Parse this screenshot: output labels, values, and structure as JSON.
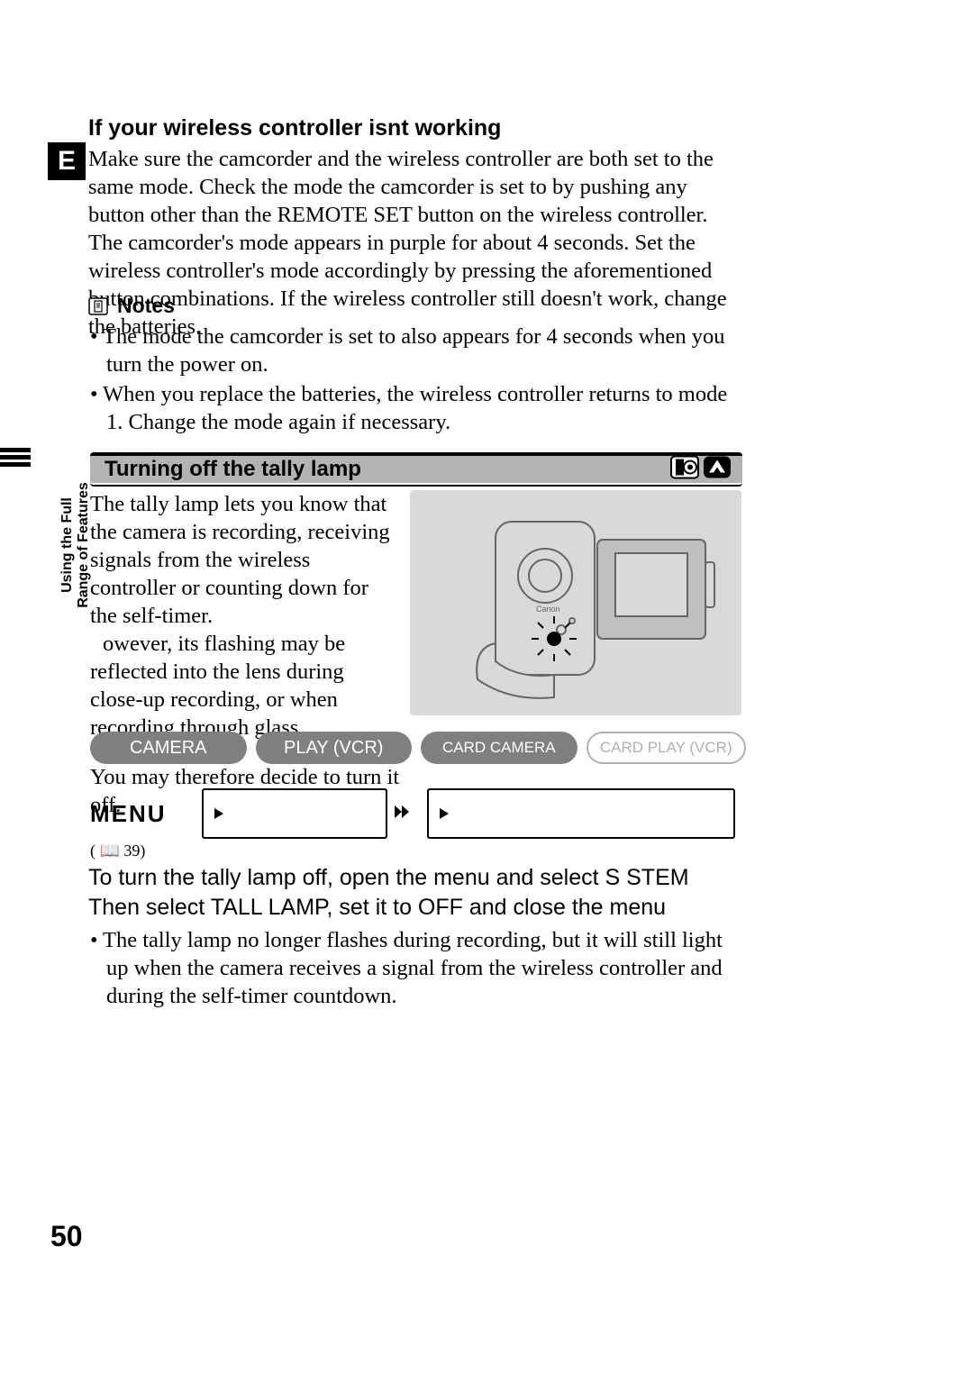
{
  "lang_badge": "E",
  "page_number": "50",
  "section1": {
    "heading": "If your wireless controller isnt working",
    "paragraph": "Make sure the camcorder and the wireless controller are both set to the same mode. Check the mode the camcorder is set to by pushing any button other than the REMOTE SET button on the wireless controller. The camcorder's mode appears in purple for about 4 seconds. Set the wireless controller's mode accordingly by pressing the aforementioned button combinations. If the wireless controller still doesn't work, change the batteries."
  },
  "notes": {
    "label": "Notes",
    "items": [
      "The mode the camcorder is set to also appears for 4 seconds when you turn the power on.",
      "When you replace the batteries, the wireless controller returns to mode 1. Change the mode again if necessary."
    ]
  },
  "section2": {
    "title": "Turning off the tally lamp",
    "para1": "The tally lamp lets you know that the camera is recording, receiving signals from the wireless controller or counting down for the self-timer.",
    "para2_leading_spaces": "   ",
    "para2": "owever, its flashing may be reflected into the lens during close-up recording, or when recording through glass.",
    "para3": "You may therefore decide to turn it off."
  },
  "side_tab": {
    "line1": "Using the Full",
    "line2": "Range of Features"
  },
  "modes": {
    "camera": "CAMERA",
    "play_vcr": "PLAY (VCR)",
    "card_camera": "CARD CAMERA",
    "card_play_vcr": "CARD PLAY (VCR)"
  },
  "menu": {
    "label": "MENU",
    "page_ref": "( 📖 39)",
    "box1": "",
    "box2": ""
  },
  "instruction": "To turn the tally lamp off, open the menu and select S   STEM  Then select TALL   LAMP, set it to OFF and close the menu",
  "instruction_bullets": [
    "The tally lamp no longer flashes during recording, but it will still light up when the camera receives a signal from the wireless controller and during the self-timer countdown."
  ]
}
